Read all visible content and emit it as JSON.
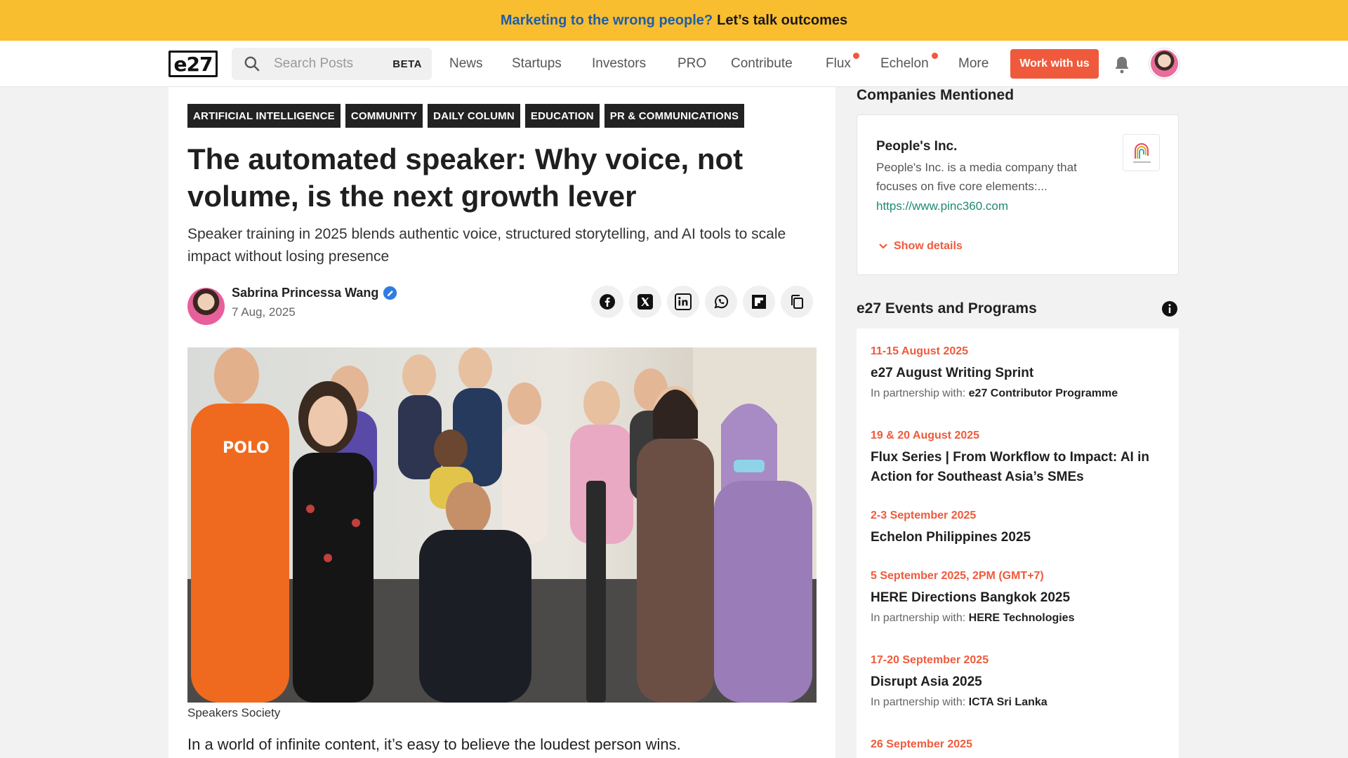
{
  "promo": {
    "highlight": "Marketing to the wrong people?",
    "rest": "Let’s talk outcomes"
  },
  "nav": {
    "logo": "e27",
    "search_placeholder": "Search Posts",
    "search_badge": "BETA",
    "items": [
      "News",
      "Startups",
      "Investors",
      "PRO",
      "Contribute",
      "Flux",
      "Echelon",
      "More"
    ],
    "cta": "Work with us",
    "icons": {
      "search": "search-icon",
      "bell": "bell-icon",
      "avatar": "user-avatar"
    },
    "accent": "#ef5a3c"
  },
  "article": {
    "tags": [
      "ARTIFICIAL INTELLIGENCE",
      "COMMUNITY",
      "DAILY COLUMN",
      "EDUCATION",
      "PR & COMMUNICATIONS"
    ],
    "title": "The automated speaker: Why voice, not volume, is the next growth lever",
    "subtitle": "Speaker training in 2025 blends authentic voice, structured storytelling, and AI tools to scale impact without losing presence",
    "author": "Sabrina Princessa Wang",
    "date": "7 Aug, 2025",
    "share_icons": [
      "facebook-icon",
      "x-icon",
      "linkedin-icon",
      "whatsapp-icon",
      "flipboard-icon",
      "copy-icon"
    ],
    "image_caption": "Speakers Society",
    "lead": "In a world of infinite content, it’s easy to believe the loudest person wins."
  },
  "sidebar": {
    "companies_heading": "Companies Mentioned",
    "company": {
      "name": "People's Inc.",
      "description": "People's Inc. is a media company that focuses on five core elements:...",
      "url": "https://www.pinc360.com",
      "show_details": "Show details"
    },
    "events_heading": "e27 Events and Programs",
    "events": [
      {
        "date": "11-15 August 2025",
        "title": "e27 August Writing Sprint",
        "partner_label": "In partnership with:",
        "partner": "e27 Contributor Programme"
      },
      {
        "date": "19 & 20 August 2025",
        "title": "Flux Series | From Workflow to Impact: AI in Action for Southeast Asia’s SMEs",
        "partner_label": "",
        "partner": ""
      },
      {
        "date": "2-3 September 2025",
        "title": "Echelon Philippines 2025",
        "partner_label": "",
        "partner": ""
      },
      {
        "date": "5 September 2025, 2PM (GMT+7)",
        "title": "HERE Directions Bangkok 2025",
        "partner_label": "In partnership with:",
        "partner": "HERE Technologies"
      },
      {
        "date": "17-20 September 2025",
        "title": "Disrupt Asia 2025",
        "partner_label": "In partnership with:",
        "partner": "ICTA Sri Lanka"
      },
      {
        "date": "26 September 2025",
        "title": "",
        "partner_label": "",
        "partner": ""
      }
    ]
  }
}
